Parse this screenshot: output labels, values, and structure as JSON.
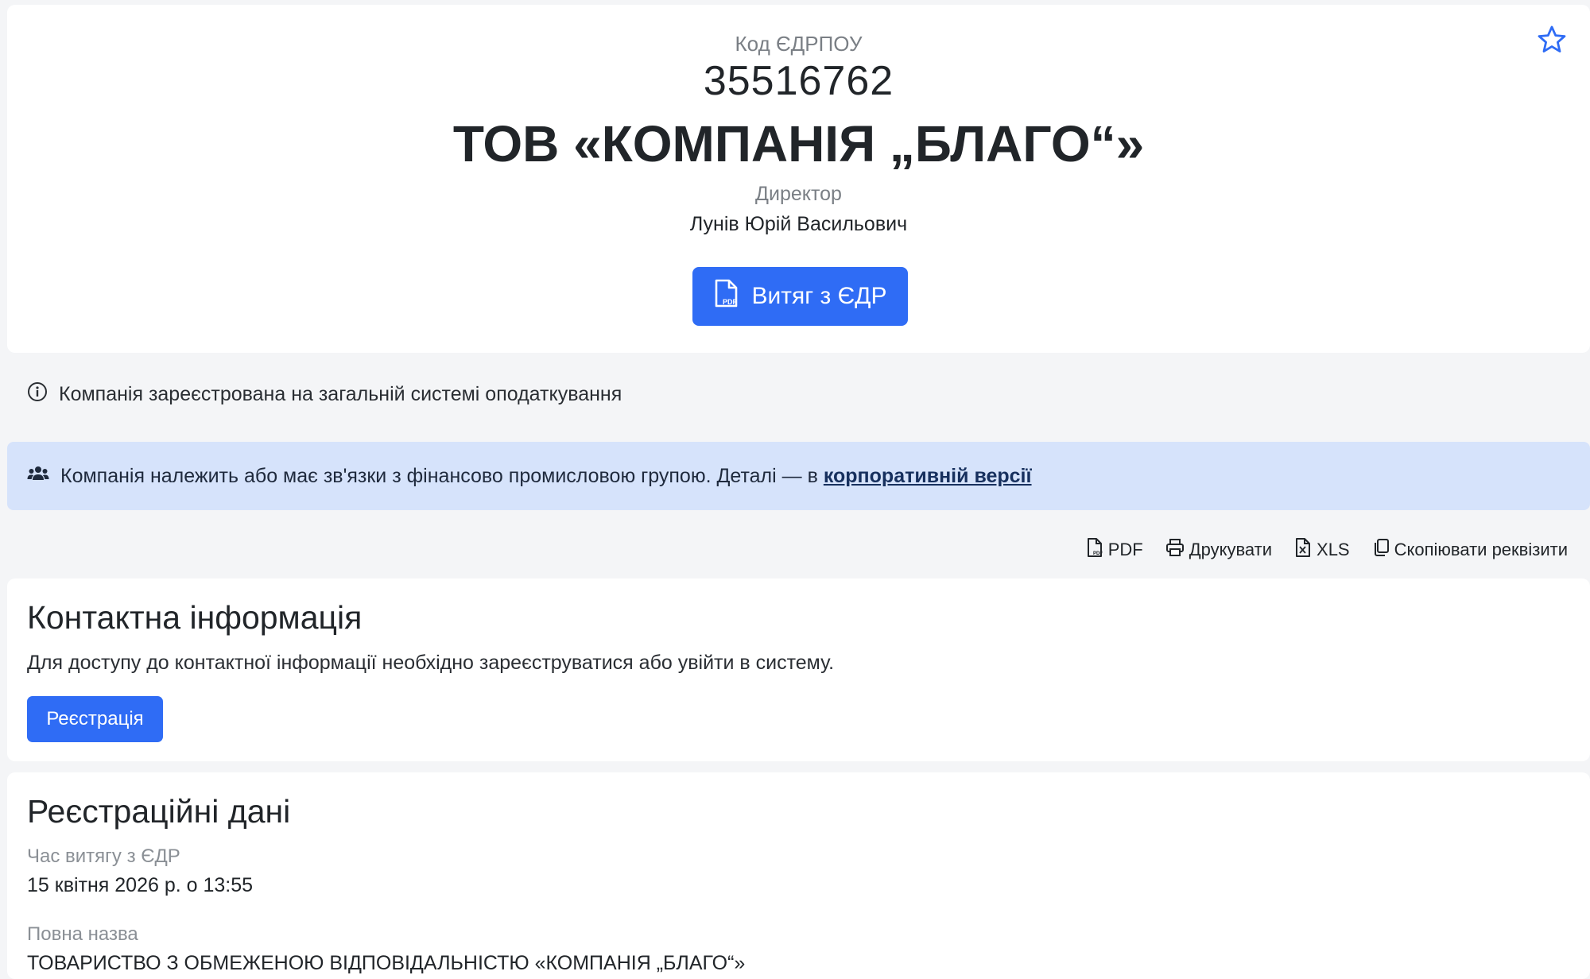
{
  "header": {
    "edrpou_label": "Код ЄДРПОУ",
    "edrpou_code": "35516762",
    "company_name": "ТОВ «КОМПАНІЯ „БЛАГО“»",
    "director_label": "Директор",
    "director_name": "Лунів Юрій Васильович",
    "extract_button_label": "Витяг з ЄДР"
  },
  "tax_notice": "Компанія зареєстрована на загальній системі оподаткування",
  "group_banner": {
    "text": "Компанія належить або має зв'язки з фінансово промисловою групою. Деталі — в",
    "link": "корпоративній версії"
  },
  "toolbar": {
    "pdf": "PDF",
    "print": "Друкувати",
    "xls": "XLS",
    "copy": "Скопіювати реквізити"
  },
  "contact": {
    "title": "Контактна інформація",
    "text": "Для доступу до контактної інформації необхідно зареєструватися або увійти в систему.",
    "register_button": "Реєстрація"
  },
  "registration": {
    "title": "Реєстраційні дані",
    "extract_time_label": "Час витягу з ЄДР",
    "extract_time_value": "15 квітня 2026 р. о 13:55",
    "full_name_label": "Повна назва",
    "full_name_value": "ТОВАРИСТВО З ОБМЕЖЕНОЮ ВІДПОВІДАЛЬНІСТЮ «КОМПАНІЯ „БЛАГО“»"
  },
  "colors": {
    "accent": "#2f6cf5",
    "banner_bg": "#d6e3fb",
    "page_bg": "#f4f5f7"
  },
  "icons": {
    "star": "star-icon",
    "pdf": "pdf-file-icon",
    "info": "info-icon",
    "group": "users-icon",
    "print": "printer-icon",
    "xls": "xls-file-icon",
    "copy": "copy-icon"
  }
}
